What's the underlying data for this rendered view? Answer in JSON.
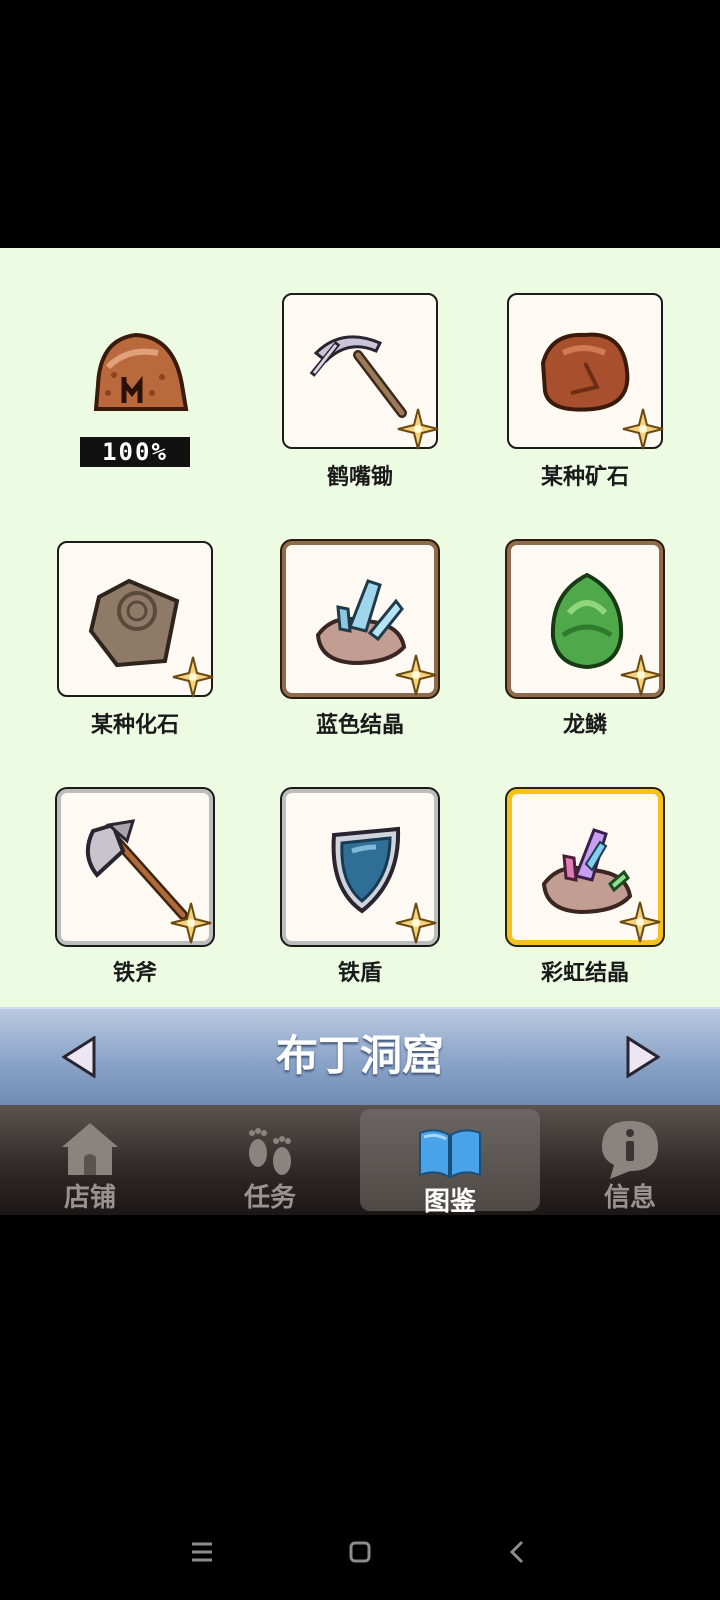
{
  "collection": {
    "completion": "100%",
    "items": [
      {
        "name": "鹤嘴锄",
        "icon": "pickaxe-icon"
      },
      {
        "name": "某种矿石",
        "icon": "ore-icon"
      },
      {
        "name": "某种化石",
        "icon": "fossil-icon"
      },
      {
        "name": "蓝色结晶",
        "icon": "blue-crystal-icon"
      },
      {
        "name": "龙鳞",
        "icon": "dragon-scale-icon"
      },
      {
        "name": "铁斧",
        "icon": "iron-axe-icon"
      },
      {
        "name": "铁盾",
        "icon": "iron-shield-icon"
      },
      {
        "name": "彩虹结晶",
        "icon": "rainbow-crystal-icon"
      }
    ]
  },
  "area": {
    "title": "布丁洞窟",
    "prev_icon": "triangle-left-icon",
    "next_icon": "triangle-right-icon"
  },
  "tabs": [
    {
      "label": "店铺",
      "icon": "home-icon"
    },
    {
      "label": "任务",
      "icon": "footprints-icon"
    },
    {
      "label": "图鉴",
      "icon": "book-icon",
      "active": true
    },
    {
      "label": "信息",
      "icon": "info-bubble-icon"
    }
  ],
  "system_nav": [
    "menu-icon",
    "home-square-icon",
    "back-icon"
  ],
  "colors": {
    "background": "#eefbe3",
    "area_bar": "#8aa3c8",
    "rare_border": "#f4c21b"
  }
}
